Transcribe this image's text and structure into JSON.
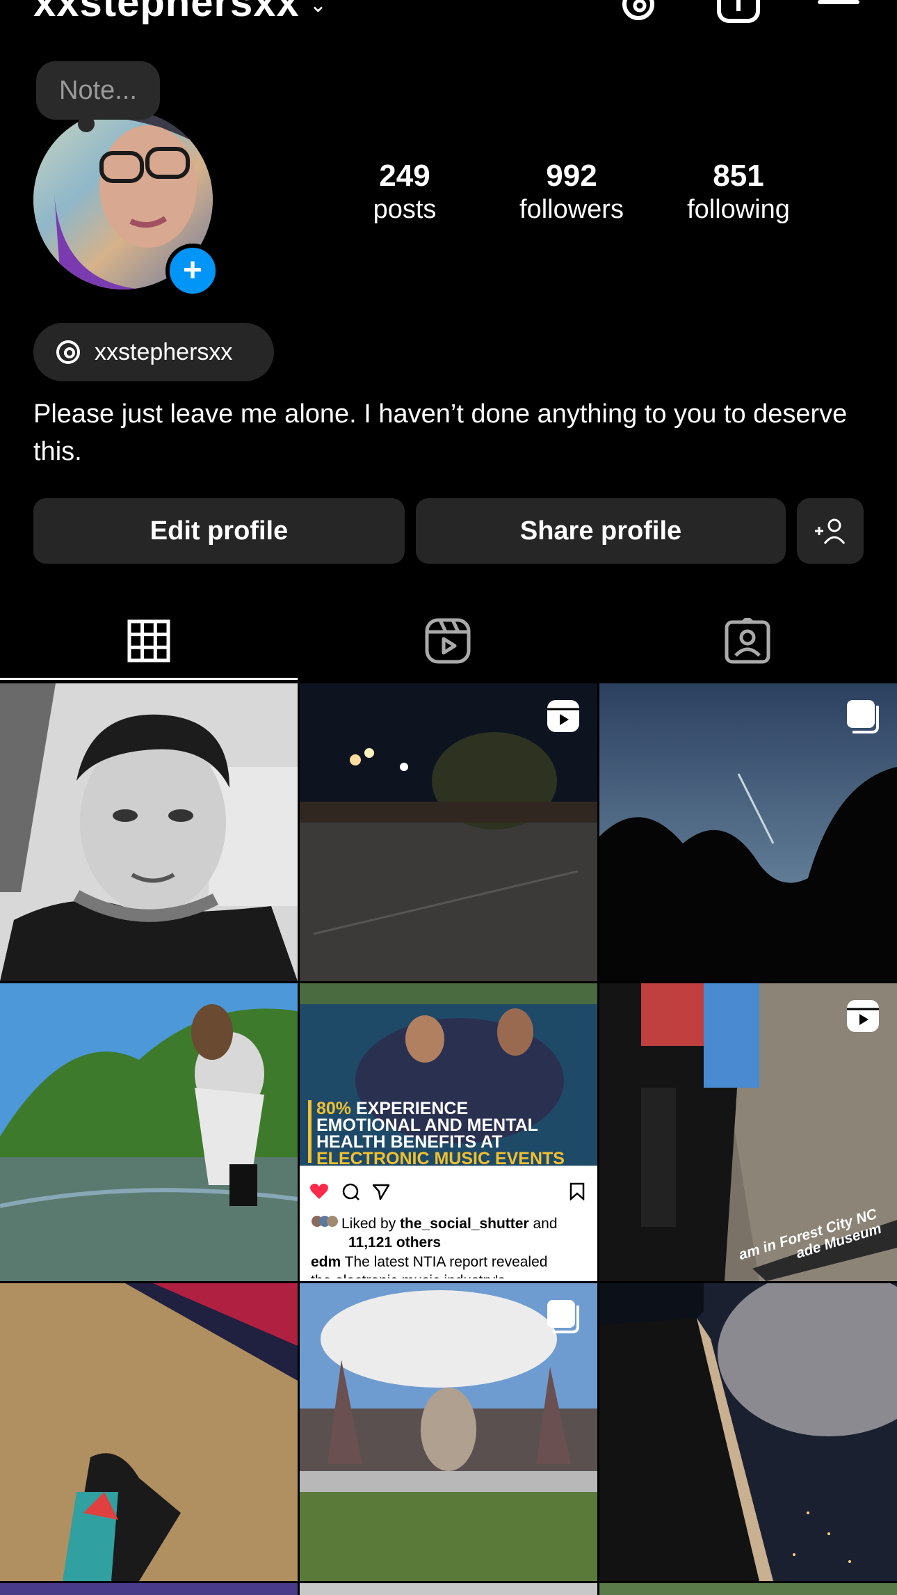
{
  "header": {
    "username": "xxstephersxx",
    "icons": [
      "threads-icon",
      "create-icon",
      "menu-icon"
    ]
  },
  "profile": {
    "note_placeholder": "Note...",
    "stats": [
      {
        "value": "249",
        "label": "posts"
      },
      {
        "value": "992",
        "label": "followers"
      },
      {
        "value": "851",
        "label": "following"
      }
    ],
    "threads_handle": "xxstephersxx",
    "bio": "Please just leave me alone. I haven’t done anything to you to deserve this."
  },
  "actions": {
    "edit": "Edit profile",
    "share": "Share profile"
  },
  "tabs": [
    "grid",
    "reels",
    "tagged"
  ],
  "colors": {
    "background": "#000000",
    "button": "#262626",
    "accent": "#0095f6"
  },
  "posts": {
    "edm_post": {
      "headline_lines": [
        "80% EXPERIENCE",
        "EMOTIONAL AND MENTAL",
        "HEALTH BENEFITS AT",
        "ELECTRONIC MUSIC EVENTS"
      ],
      "liked_by_prefix": "Liked by ",
      "liked_by_user": "the_social_shutter",
      "liked_by_suffix": " and",
      "others": "11,121 others",
      "caption_user": "edm",
      "caption_text": " The latest NTIA report revealed",
      "caption_cut": "the electronic music industry's"
    },
    "museum_caption": [
      "am in Forest City NC",
      "ade Museum"
    ]
  }
}
